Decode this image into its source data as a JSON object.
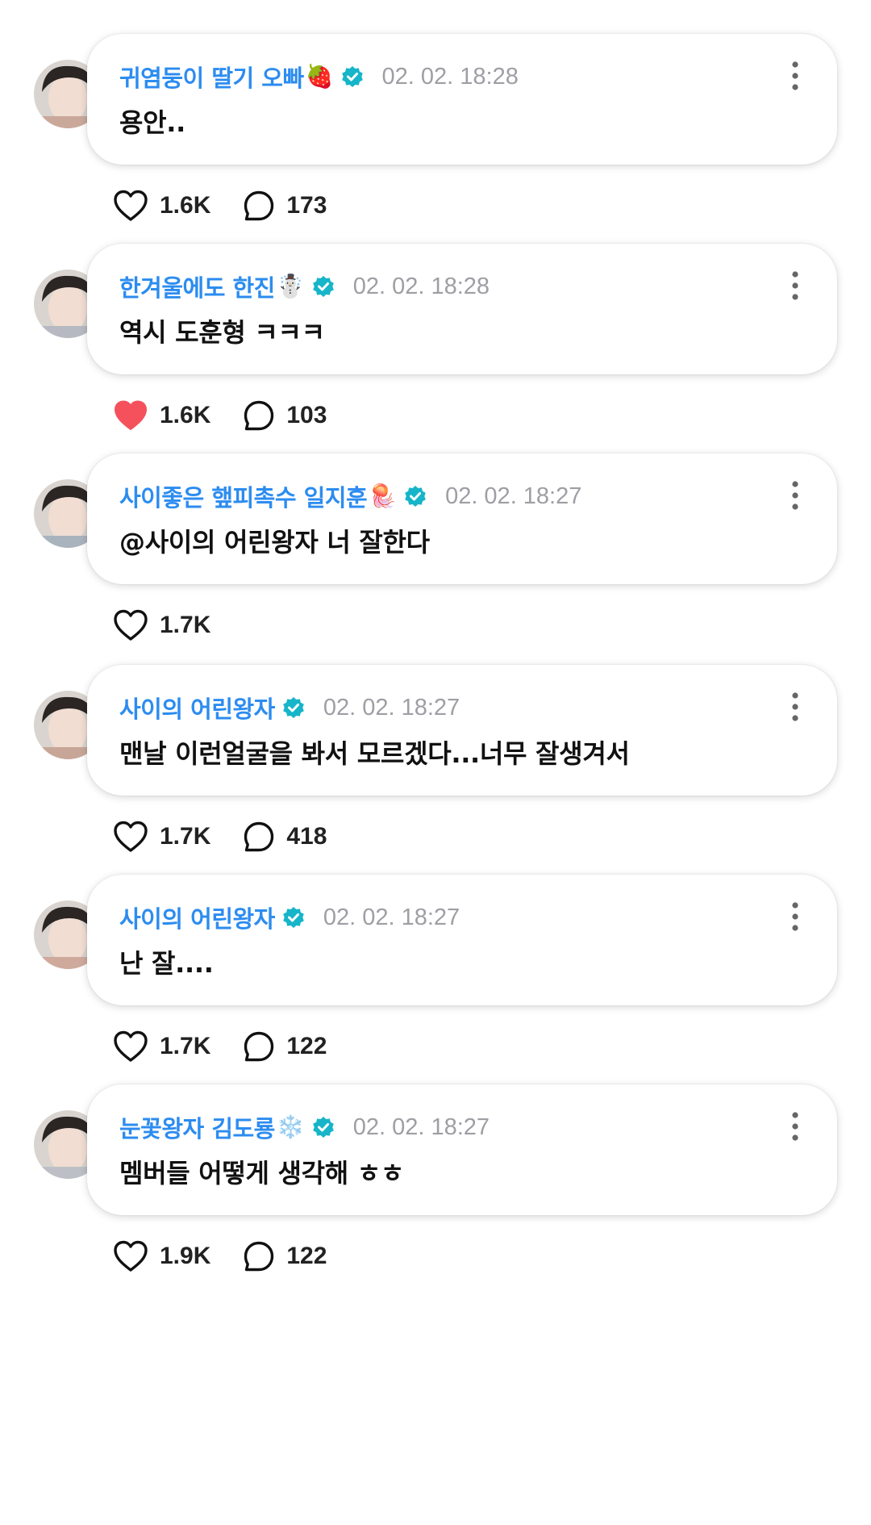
{
  "comments": [
    {
      "username": "귀염둥이 딸기 오빠",
      "emoji": "🍓",
      "timestamp": "02. 02. 18:28",
      "content": "용안..",
      "likes": "1.6K",
      "liked": false,
      "replies": "173",
      "avatar_color": "#c9a89a"
    },
    {
      "username": "한겨울에도 한진",
      "emoji": "☃️",
      "timestamp": "02. 02. 18:28",
      "content": "역시 도훈형 ㅋㅋㅋ",
      "likes": "1.6K",
      "liked": true,
      "replies": "103",
      "avatar_color": "#b7b9c2"
    },
    {
      "username": "사이좋은 햎피촉수 일지훈",
      "emoji": "🪼",
      "timestamp": "02. 02. 18:27",
      "content": "@사이의 어린왕자 너 잘한다",
      "likes": "1.7K",
      "liked": false,
      "replies": null,
      "avatar_color": "#a9b3bd"
    },
    {
      "username": "사이의 어린왕자",
      "emoji": "",
      "timestamp": "02. 02. 18:27",
      "content": "맨날 이런얼굴을 봐서 모르겠다...너무 잘생겨서",
      "likes": "1.7K",
      "liked": false,
      "replies": "418",
      "avatar_color": "#c7a698"
    },
    {
      "username": "사이의 어린왕자",
      "emoji": "",
      "timestamp": "02. 02. 18:27",
      "content": "난 잘....",
      "likes": "1.7K",
      "liked": false,
      "replies": "122",
      "avatar_color": "#cfa99c"
    },
    {
      "username": "눈꽃왕자 김도룡",
      "emoji": "❄️",
      "timestamp": "02. 02. 18:27",
      "content": "멤버들 어떻게 생각해 ㅎㅎ",
      "likes": "1.9K",
      "liked": false,
      "replies": "122",
      "avatar_color": "#bcc0c6"
    }
  ],
  "colors": {
    "username": "#2c8cf0",
    "verified": "#16b5c9",
    "timestamp": "#9e9ea4",
    "liked_heart": "#f4515c"
  },
  "icons": {
    "verified": "verified-badge-icon",
    "more": "more-vertical-icon",
    "like": "heart-icon",
    "reply": "speech-bubble-icon"
  }
}
